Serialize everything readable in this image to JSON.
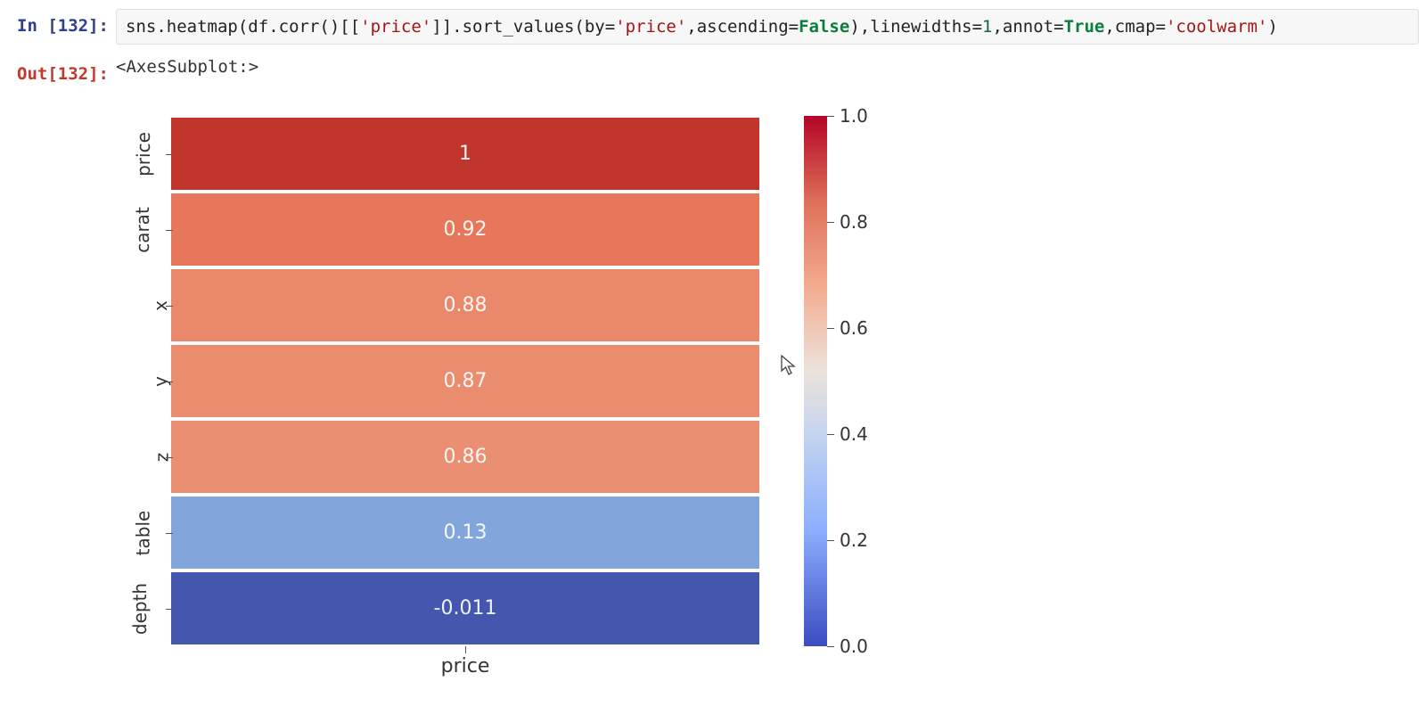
{
  "prompt_in": "In [132]:",
  "prompt_out": "Out[132]:",
  "code_tokens": [
    {
      "t": "sns",
      "c": "tok-name"
    },
    {
      "t": ".",
      "c": "tok-name"
    },
    {
      "t": "heatmap",
      "c": "tok-name"
    },
    {
      "t": "(df",
      "c": "tok-name"
    },
    {
      "t": ".",
      "c": "tok-name"
    },
    {
      "t": "corr",
      "c": "tok-name"
    },
    {
      "t": "()[[",
      "c": "tok-name"
    },
    {
      "t": "'price'",
      "c": "tok-str"
    },
    {
      "t": "]].",
      "c": "tok-name"
    },
    {
      "t": "sort_values",
      "c": "tok-name"
    },
    {
      "t": "(by=",
      "c": "tok-name"
    },
    {
      "t": "'price'",
      "c": "tok-str"
    },
    {
      "t": ",ascending=",
      "c": "tok-name"
    },
    {
      "t": "False",
      "c": "tok-bool"
    },
    {
      "t": "),linewidths=",
      "c": "tok-name"
    },
    {
      "t": "1",
      "c": "tok-num"
    },
    {
      "t": ",annot=",
      "c": "tok-name"
    },
    {
      "t": "True",
      "c": "tok-bool"
    },
    {
      "t": ",cmap=",
      "c": "tok-name"
    },
    {
      "t": "'coolwarm'",
      "c": "tok-str"
    },
    {
      "t": ")",
      "c": "tok-name"
    }
  ],
  "output_repr": "<AxesSubplot:>",
  "chart_data": {
    "type": "heatmap",
    "cmap": "coolwarm",
    "linewidths": 1,
    "annot": true,
    "xlabel": "price",
    "xticks": [
      "price"
    ],
    "yticks": [
      "price",
      "carat",
      "x",
      "y",
      "z",
      "table",
      "depth"
    ],
    "values": [
      1,
      0.92,
      0.88,
      0.87,
      0.86,
      0.13,
      -0.011
    ],
    "annot_text": [
      "1",
      "0.92",
      "0.88",
      "0.87",
      "0.86",
      "0.13",
      "-0.011"
    ],
    "colorbar_range": [
      0.0,
      1.0
    ],
    "colorbar_ticks": [
      0.0,
      0.2,
      0.4,
      0.6,
      0.8,
      1.0
    ],
    "cell_colors": [
      "#c0362c",
      "#e6775a",
      "#e9886a",
      "#ea8c6e",
      "#ea8f72",
      "#82a5db",
      "#4257ad"
    ]
  }
}
